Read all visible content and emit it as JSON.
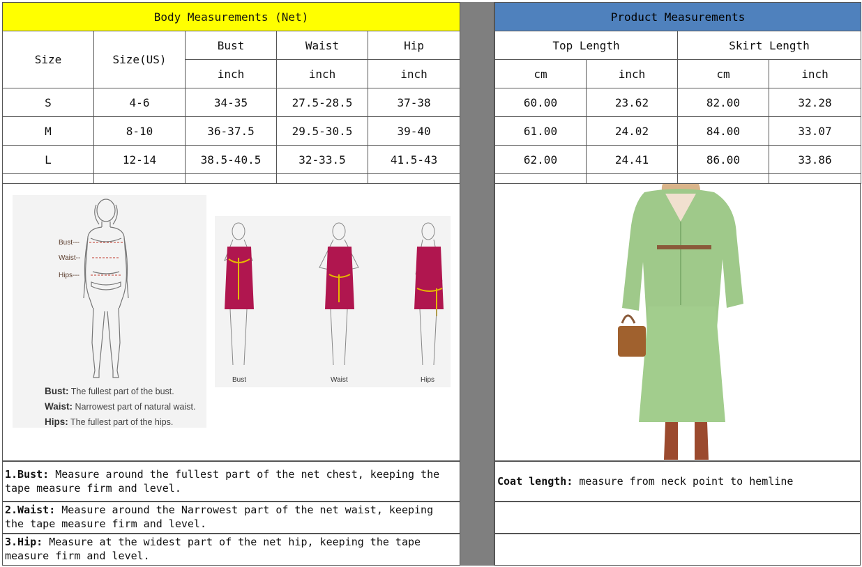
{
  "left": {
    "title": "Body Measurements (Net)",
    "col_size": "Size",
    "col_size_us": "Size(US)",
    "col_bust": "Bust",
    "col_waist": "Waist",
    "col_hip": "Hip",
    "unit": "inch",
    "rows": [
      {
        "size": "S",
        "us": "4-6",
        "bust": "34-35",
        "waist": "27.5-28.5",
        "hip": "37-38"
      },
      {
        "size": "M",
        "us": "8-10",
        "bust": "36-37.5",
        "waist": "29.5-30.5",
        "hip": "39-40"
      },
      {
        "size": "L",
        "us": "12-14",
        "bust": "38.5-40.5",
        "waist": "32-33.5",
        "hip": "41.5-43"
      }
    ]
  },
  "right": {
    "title": "Product Measurements",
    "col_top": "Top Length",
    "col_skirt": "Skirt Length",
    "unit_cm": "cm",
    "unit_inch": "inch",
    "rows": [
      {
        "top_cm": "60.00",
        "top_in": "23.62",
        "skirt_cm": "82.00",
        "skirt_in": "32.28"
      },
      {
        "top_cm": "61.00",
        "top_in": "24.02",
        "skirt_cm": "84.00",
        "skirt_in": "33.07"
      },
      {
        "top_cm": "62.00",
        "top_in": "24.41",
        "skirt_cm": "86.00",
        "skirt_in": "33.86"
      }
    ]
  },
  "figure1": {
    "label_bust": "Bust---",
    "label_waist": "Waist--",
    "label_hips": "Hips---",
    "def_bust_term": "Bust:",
    "def_bust_text": "The fullest part of the bust.",
    "def_waist_term": "Waist:",
    "def_waist_text": "Narrowest part of natural waist.",
    "def_hips_term": "Hips:",
    "def_hips_text": "The fullest part of the hips."
  },
  "figure2": {
    "cap_bust": "Bust",
    "cap_waist": "Waist",
    "cap_hips": "Hips"
  },
  "notes": {
    "bust_term": "1.Bust:",
    "bust_text": "  Measure around the fullest part of the net chest, keeping the tape  measure firm and level.",
    "waist_term": "2.Waist:",
    "waist_text": " Measure around the Narrowest part of the net waist, keeping the tape  measure firm and level.",
    "hip_term": "3.Hip:",
    "hip_text": " Measure at the widest part of the net hip, keeping the tape measure firm and level.",
    "coat_term": "Coat length:",
    "coat_text": " measure from neck point to hemline"
  },
  "colors": {
    "header_yellow": "#ffff00",
    "header_blue": "#4f81bd",
    "gutter_gray": "#7f7f7f",
    "dress": "#b0164f",
    "tape": "#e6b800",
    "knit_green": "#9fc98a"
  }
}
